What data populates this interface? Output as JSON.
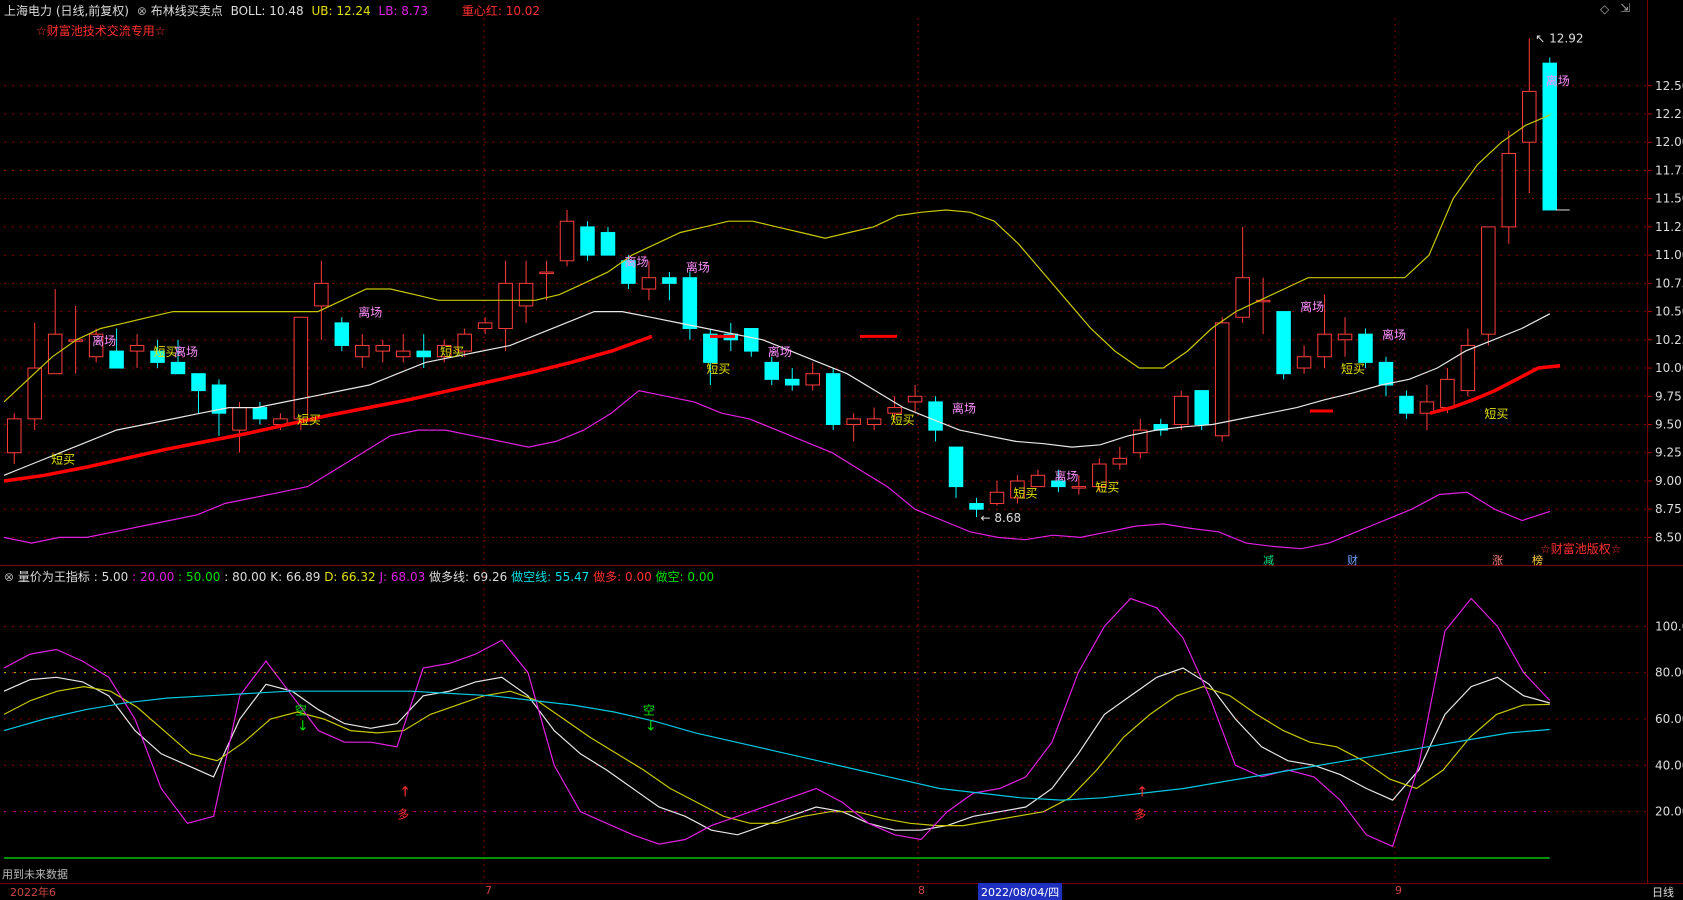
{
  "header": {
    "stock": "上海电力 (日线,前复权)",
    "indicator_name": "布林线买卖点",
    "boll": "BOLL: 10.48",
    "ub": "UB: 12.24",
    "lb": "LB: 8.73",
    "zxh": "重心红: 10.02",
    "watermark_text": "☆财富池技术交流专用☆"
  },
  "sub_header": {
    "name": "量价为王指标 : 5.00",
    "p20": ": 20.00",
    "p50": ": 50.00",
    "p80": ": 80.00",
    "k": "K: 66.89",
    "d": "D: 66.32",
    "j": "J: 68.03",
    "zdx": "做多线: 69.26",
    "zkx": "做空线: 55.47",
    "zd": "做多: 0.00",
    "zk": "做空: 0.00"
  },
  "footer": {
    "future_data_note": "用到未来数据",
    "period": "日线",
    "cursor_date": "2022/08/04/四",
    "dates": [
      "2022年6",
      "7",
      "8",
      "9"
    ]
  },
  "bottom_right_mark": "☆财富池版权☆",
  "right_labels": [
    "减",
    "财",
    "涨",
    "榜"
  ],
  "colors": {
    "up": "#ff3c3c",
    "down": "#00ffff",
    "ub": "#c8c800",
    "mid": "#e8e8e8",
    "lb": "#e020e0",
    "zxh": "#ff0000",
    "k": "#e8e8e8",
    "d": "#c8c800",
    "j": "#e020e0",
    "zkx": "#00c8e0",
    "grid": "#8b0000"
  },
  "chart_data": [
    {
      "type": "candlestick",
      "title": "布林线买卖点",
      "ylim": [
        8.3,
        13.1
      ],
      "y_ticks": [
        "8.50",
        "8.75",
        "9.00",
        "9.25",
        "9.50",
        "9.75",
        "10.00",
        "10.25",
        "10.50",
        "10.75",
        "11.00",
        "11.25",
        "11.50",
        "11.75",
        "12.00",
        "12.25",
        "12.50"
      ],
      "candles": [
        [
          9.25,
          9.55,
          9.15,
          9.6
        ],
        [
          9.55,
          10.0,
          9.45,
          10.4
        ],
        [
          9.95,
          10.3,
          9.95,
          10.7
        ],
        [
          10.25,
          10.25,
          9.95,
          10.55
        ],
        [
          10.1,
          10.3,
          10.05,
          10.35
        ],
        [
          10.15,
          10.0,
          10.0,
          10.35
        ],
        [
          10.15,
          10.2,
          10.0,
          10.3
        ],
        [
          10.15,
          10.05,
          10.0,
          10.25
        ],
        [
          10.05,
          9.95,
          9.95,
          10.25
        ],
        [
          9.95,
          9.8,
          9.6,
          9.95
        ],
        [
          9.85,
          9.6,
          9.4,
          9.9
        ],
        [
          9.45,
          9.65,
          9.25,
          9.7
        ],
        [
          9.65,
          9.55,
          9.5,
          9.7
        ],
        [
          9.5,
          9.55,
          9.45,
          9.6
        ],
        [
          9.55,
          10.45,
          9.45,
          10.45
        ],
        [
          10.55,
          10.75,
          10.25,
          10.95
        ],
        [
          10.4,
          10.2,
          10.15,
          10.45
        ],
        [
          10.1,
          10.2,
          10.0,
          10.3
        ],
        [
          10.15,
          10.2,
          10.05,
          10.25
        ],
        [
          10.1,
          10.15,
          10.05,
          10.3
        ],
        [
          10.15,
          10.1,
          10.0,
          10.3
        ],
        [
          10.1,
          10.2,
          10.05,
          10.25
        ],
        [
          10.15,
          10.3,
          10.1,
          10.35
        ],
        [
          10.35,
          10.4,
          10.3,
          10.45
        ],
        [
          10.35,
          10.75,
          10.15,
          10.95
        ],
        [
          10.55,
          10.75,
          10.4,
          10.95
        ],
        [
          10.85,
          10.85,
          10.6,
          10.95
        ],
        [
          10.95,
          11.3,
          10.9,
          11.4
        ],
        [
          11.25,
          11.0,
          10.95,
          11.3
        ],
        [
          11.2,
          11.0,
          11.0,
          11.25
        ],
        [
          10.95,
          10.75,
          10.7,
          11.0
        ],
        [
          10.7,
          10.8,
          10.6,
          10.95
        ],
        [
          10.8,
          10.75,
          10.6,
          10.85
        ],
        [
          10.8,
          10.35,
          10.25,
          10.85
        ],
        [
          10.3,
          10.05,
          9.85,
          10.35
        ],
        [
          10.3,
          10.25,
          10.15,
          10.4
        ],
        [
          10.35,
          10.15,
          10.1,
          10.35
        ],
        [
          10.05,
          9.9,
          9.85,
          10.1
        ],
        [
          9.9,
          9.85,
          9.8,
          10.0
        ],
        [
          9.85,
          9.95,
          9.8,
          10.05
        ],
        [
          9.95,
          9.5,
          9.45,
          10.0
        ],
        [
          9.5,
          9.55,
          9.35,
          9.6
        ],
        [
          9.5,
          9.55,
          9.45,
          9.65
        ],
        [
          9.6,
          9.65,
          9.55,
          9.75
        ],
        [
          9.7,
          9.75,
          9.6,
          9.85
        ],
        [
          9.7,
          9.45,
          9.35,
          9.75
        ],
        [
          9.3,
          8.95,
          8.85,
          9.3
        ],
        [
          8.8,
          8.75,
          8.68,
          8.85
        ],
        [
          8.8,
          8.9,
          8.78,
          9.0
        ],
        [
          8.85,
          9.0,
          8.8,
          9.05
        ],
        [
          8.95,
          9.05,
          8.95,
          9.1
        ],
        [
          9.0,
          8.95,
          8.9,
          9.1
        ],
        [
          8.95,
          8.95,
          8.88,
          9.05
        ],
        [
          8.95,
          9.15,
          8.9,
          9.2
        ],
        [
          9.15,
          9.2,
          9.1,
          9.3
        ],
        [
          9.25,
          9.45,
          9.2,
          9.55
        ],
        [
          9.5,
          9.45,
          9.4,
          9.55
        ],
        [
          9.5,
          9.75,
          9.45,
          9.8
        ],
        [
          9.8,
          9.5,
          9.45,
          9.8
        ],
        [
          9.4,
          10.4,
          9.35,
          10.45
        ],
        [
          10.45,
          10.8,
          10.4,
          11.25
        ],
        [
          10.6,
          10.6,
          10.3,
          10.8
        ],
        [
          10.5,
          9.95,
          9.9,
          10.5
        ],
        [
          10.0,
          10.1,
          9.95,
          10.2
        ],
        [
          10.1,
          10.3,
          10.0,
          10.65
        ],
        [
          10.25,
          10.3,
          10.1,
          10.45
        ],
        [
          10.3,
          10.05,
          10.0,
          10.35
        ],
        [
          10.05,
          9.85,
          9.75,
          10.1
        ],
        [
          9.75,
          9.6,
          9.55,
          9.8
        ],
        [
          9.6,
          9.7,
          9.45,
          9.85
        ],
        [
          9.65,
          9.9,
          9.6,
          10.0
        ],
        [
          9.8,
          10.2,
          9.75,
          10.35
        ],
        [
          10.3,
          11.25,
          10.2,
          11.25
        ],
        [
          11.25,
          11.9,
          11.1,
          12.1
        ],
        [
          12.0,
          12.45,
          11.55,
          12.92
        ],
        [
          12.7,
          11.4,
          11.4,
          12.75
        ]
      ],
      "ub": [
        9.7,
        9.9,
        10.1,
        10.25,
        10.35,
        10.4,
        10.45,
        10.5,
        10.5,
        10.5,
        10.5,
        10.5,
        10.5,
        10.5,
        10.6,
        10.7,
        10.7,
        10.65,
        10.6,
        10.6,
        10.6,
        10.6,
        10.6,
        10.65,
        10.75,
        10.85,
        11.0,
        11.1,
        11.2,
        11.25,
        11.3,
        11.3,
        11.25,
        11.2,
        11.15,
        11.2,
        11.25,
        11.35,
        11.38,
        11.4,
        11.38,
        11.3,
        11.1,
        10.85,
        10.6,
        10.35,
        10.15,
        10.0,
        10.0,
        10.15,
        10.35,
        10.5,
        10.6,
        10.7,
        10.8,
        10.8,
        10.8,
        10.8,
        10.8,
        11.0,
        11.5,
        11.8,
        12.0,
        12.15,
        12.24
      ],
      "mid": [
        9.05,
        9.15,
        9.25,
        9.35,
        9.45,
        9.5,
        9.55,
        9.6,
        9.65,
        9.65,
        9.7,
        9.75,
        9.8,
        9.85,
        9.95,
        10.05,
        10.1,
        10.15,
        10.2,
        10.3,
        10.4,
        10.5,
        10.5,
        10.45,
        10.4,
        10.35,
        10.3,
        10.25,
        10.15,
        10.05,
        9.95,
        9.8,
        9.65,
        9.55,
        9.45,
        9.4,
        9.35,
        9.33,
        9.3,
        9.32,
        9.4,
        9.45,
        9.48,
        9.5,
        9.55,
        9.6,
        9.65,
        9.72,
        9.78,
        9.85,
        9.9,
        10.0,
        10.15,
        10.25,
        10.35,
        10.48
      ],
      "lb": [
        8.5,
        8.45,
        8.5,
        8.5,
        8.55,
        8.6,
        8.65,
        8.7,
        8.8,
        8.85,
        8.9,
        8.95,
        9.1,
        9.25,
        9.4,
        9.45,
        9.45,
        9.4,
        9.35,
        9.3,
        9.35,
        9.45,
        9.6,
        9.8,
        9.75,
        9.7,
        9.6,
        9.55,
        9.45,
        9.35,
        9.25,
        9.1,
        8.95,
        8.75,
        8.65,
        8.55,
        8.5,
        8.48,
        8.52,
        8.5,
        8.55,
        8.6,
        8.62,
        8.58,
        8.55,
        8.45,
        8.42,
        8.4,
        8.45,
        8.55,
        8.65,
        8.75,
        8.88,
        8.9,
        8.75,
        8.65,
        8.73
      ]
    },
    {
      "type": "line",
      "title": "量价为王指标",
      "ylim": [
        0,
        120
      ],
      "y_ticks": [
        "20.00",
        "40.00",
        "60.00",
        "80.00",
        "100.00"
      ],
      "series": [
        {
          "name": "K",
          "values": [
            72,
            77,
            78,
            76,
            70,
            55,
            45,
            40,
            35,
            60,
            75,
            72,
            64,
            58,
            56,
            58,
            70,
            72,
            76,
            78,
            70,
            55,
            45,
            38,
            30,
            22,
            18,
            12,
            10,
            14,
            18,
            22,
            20,
            15,
            12,
            12,
            14,
            18,
            20,
            22,
            30,
            45,
            62,
            70,
            78,
            82,
            75,
            60,
            48,
            42,
            40,
            36,
            30,
            25,
            38,
            62,
            74,
            78,
            70,
            66.89
          ]
        },
        {
          "name": "D",
          "values": [
            62,
            68,
            72,
            74,
            72,
            65,
            55,
            45,
            42,
            50,
            60,
            63,
            60,
            55,
            54,
            55,
            62,
            66,
            70,
            72,
            68,
            60,
            52,
            45,
            38,
            30,
            24,
            18,
            15,
            15,
            18,
            20,
            20,
            17,
            15,
            14,
            14,
            16,
            18,
            20,
            26,
            38,
            52,
            62,
            70,
            74,
            70,
            62,
            55,
            50,
            48,
            42,
            34,
            30,
            38,
            52,
            62,
            66,
            66.32
          ]
        },
        {
          "name": "J",
          "values": [
            82,
            88,
            90,
            85,
            78,
            60,
            30,
            15,
            18,
            70,
            85,
            70,
            55,
            50,
            50,
            48,
            82,
            84,
            88,
            94,
            80,
            40,
            20,
            15,
            10,
            6,
            8,
            14,
            18,
            22,
            26,
            30,
            24,
            15,
            10,
            8,
            20,
            28,
            30,
            35,
            50,
            80,
            100,
            112,
            108,
            95,
            70,
            40,
            35,
            38,
            35,
            25,
            10,
            5,
            40,
            98,
            112,
            100,
            80,
            68.03
          ]
        },
        {
          "name": "做空线",
          "values": [
            55,
            60,
            64,
            67,
            69,
            70,
            71,
            72,
            72,
            72,
            72,
            71,
            70,
            68,
            66,
            63,
            59,
            54,
            50,
            46,
            42,
            38,
            34,
            30,
            28,
            26,
            25,
            26,
            28,
            30,
            33,
            36,
            39,
            42,
            45,
            48,
            51,
            54,
            55.47
          ]
        }
      ],
      "arrows": [
        {
          "label": "空",
          "dir": "down"
        },
        {
          "label": "空",
          "dir": "down"
        },
        {
          "label": "多",
          "dir": "up"
        },
        {
          "label": "多",
          "dir": "up"
        }
      ]
    }
  ],
  "annotations": {
    "short_buy": "短买",
    "leave": "离场",
    "low_price": "8.68",
    "high_price": "12.92"
  }
}
